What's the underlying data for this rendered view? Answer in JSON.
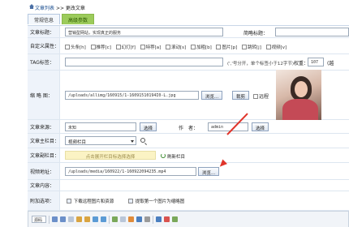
{
  "breadcrumb": {
    "root": "文章列表",
    "sep": ">>",
    "current": "更改文章"
  },
  "tabs": [
    {
      "label": "常规信息"
    },
    {
      "label": "高级参数"
    }
  ],
  "fields": {
    "title_label": "文章标题：",
    "title_value": "营销型网站，实现真正的服务",
    "short_title_label": "简略标题：",
    "attrs_label": "自定义属性：",
    "attrs": [
      "头条[h]",
      "推荐[c]",
      "幻灯[f]",
      "特荐[a]",
      "滚动[s]",
      "加粗[b]",
      "图片[p]",
      "跳转[j]",
      "视频[v]"
    ],
    "tag_label": "TAG标签：",
    "tag_note": "(','号分开，单个标签小于12字节)",
    "weight_label": "权重：",
    "weight_value": "107",
    "weight_extra": "(越",
    "thumb_label": "缩 略 图：",
    "thumb_value": "/uploads/allimg/160915/1-16091510194I0-L.jpg",
    "browse_label": "浏览...",
    "crop_label": "裁剪",
    "remote_label": "远程",
    "source_label": "文章来源：",
    "source_value": "未知",
    "select_label": "选择",
    "author_label": "作　者：",
    "author_value": "admin",
    "column_label": "文章主栏目：",
    "column_value": "视频栏目",
    "subcolumn_label": "文章副栏目：",
    "subcolumn_hint": "点击展开栏目标选择选择",
    "subcolumn_refresh": "刷新栏目",
    "video_label": "视频地址：",
    "video_value": "/uploads/media/160922/1-160922094235.mp4",
    "content_label": "文章内容：",
    "options_label": "附加选项：",
    "option1": "下载远程图片和资源",
    "option2": "提取第一个图片为缩略图",
    "source_btn": "源码"
  },
  "colors": {
    "accent_tab": "#9ccb5b",
    "arrow": "#e0342a"
  }
}
